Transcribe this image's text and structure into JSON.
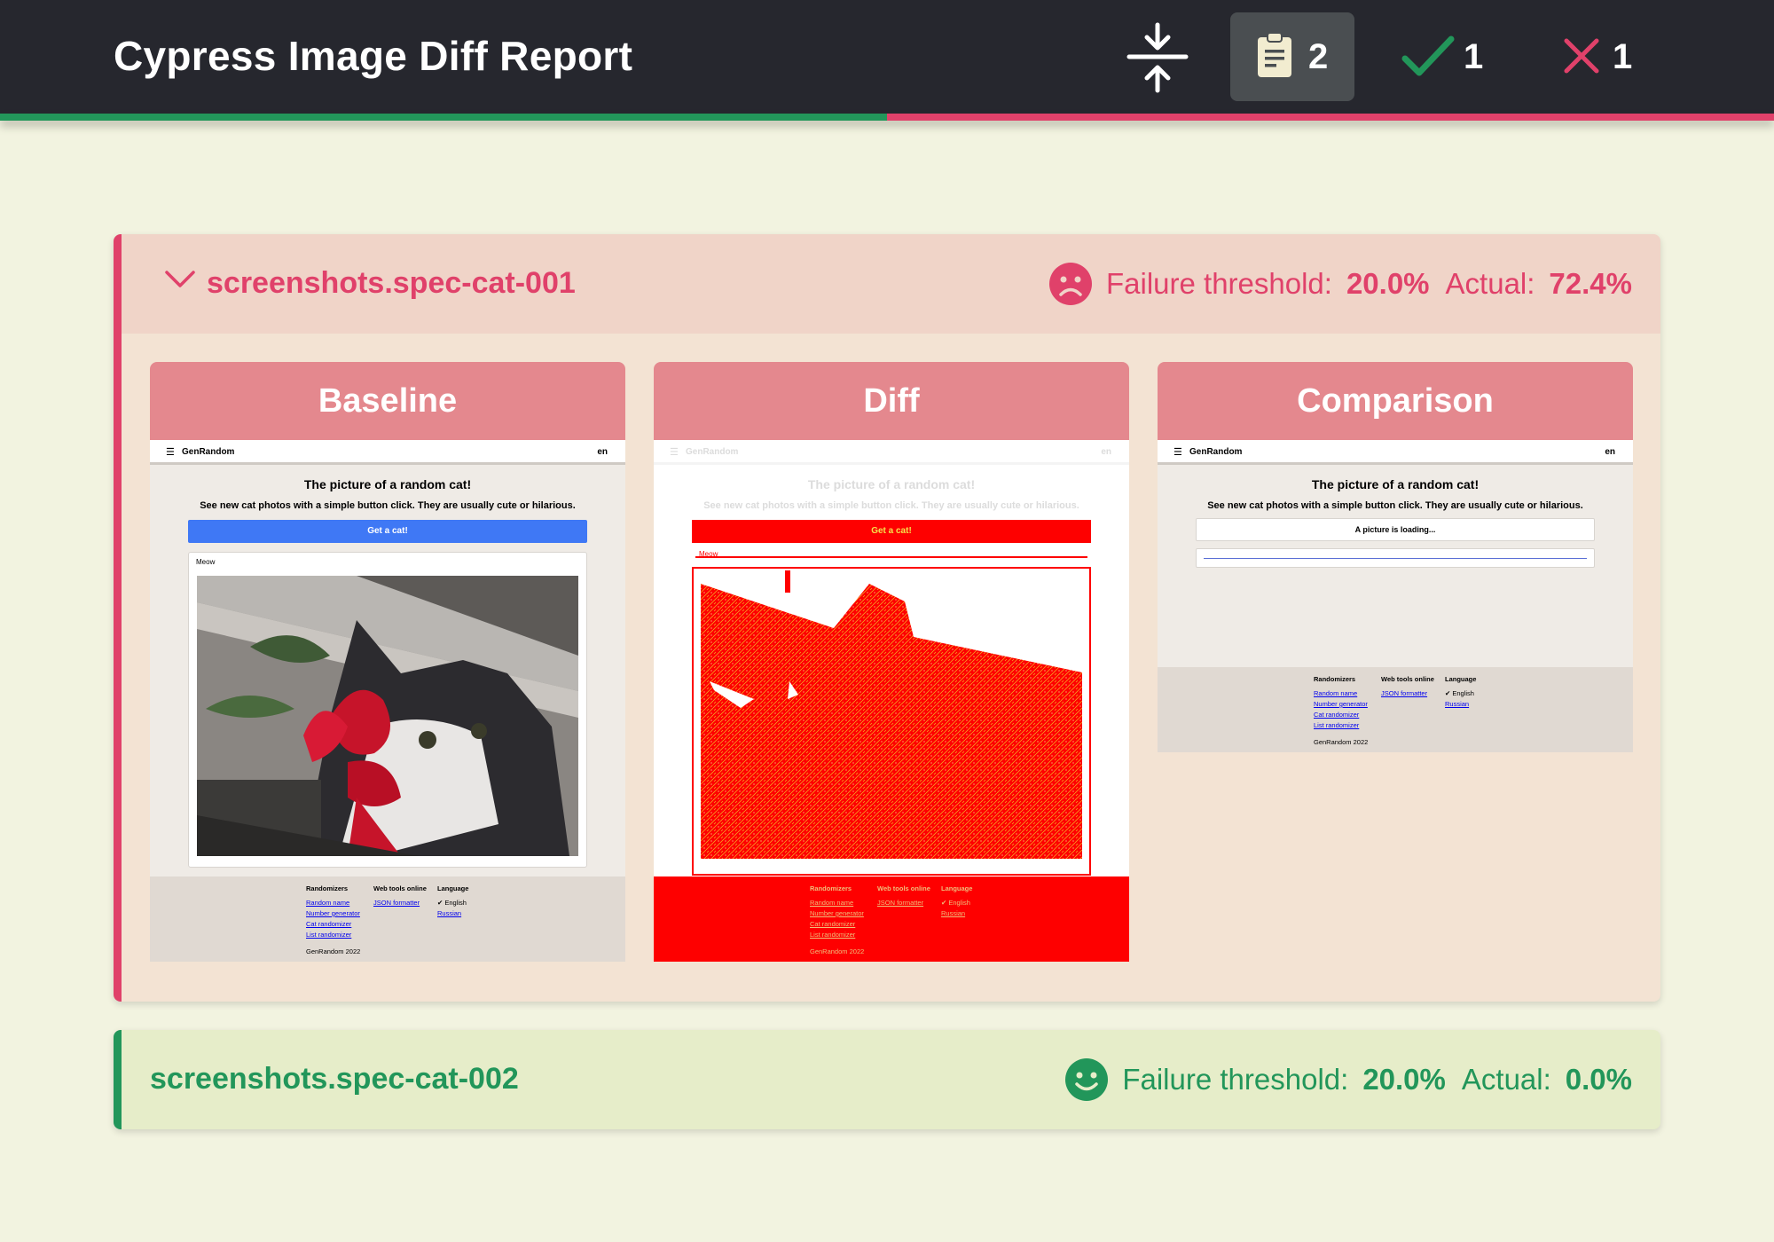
{
  "header": {
    "title": "Cypress Image Diff Report",
    "total_count": "2",
    "pass_count": "1",
    "fail_count": "1"
  },
  "colors": {
    "pass": "#22965a",
    "fail": "#e0416a",
    "header_bg": "#26272e",
    "panel_head": "#e4888e",
    "diff_red": "#fe0000"
  },
  "tests": [
    {
      "name": "screenshots.spec-cat-001",
      "status": "failed",
      "threshold_label": "Failure threshold:",
      "threshold": "20.0%",
      "actual_label": "Actual:",
      "actual": "72.4%",
      "expanded": true,
      "panels": {
        "baseline": "Baseline",
        "diff": "Diff",
        "comparison": "Comparison"
      }
    },
    {
      "name": "screenshots.spec-cat-002",
      "status": "passed",
      "threshold_label": "Failure threshold:",
      "threshold": "20.0%",
      "actual_label": "Actual:",
      "actual": "0.0%",
      "expanded": false
    }
  ],
  "shot": {
    "brand": "GenRandom",
    "lang": "en",
    "heading": "The picture of a random cat!",
    "subtitle": "See new cat photos with a simple button click. They are usually cute or hilarious.",
    "button": "Get a cat!",
    "caption": "Meow",
    "loading": "A picture is loading...",
    "diff_button_text": "Get a cat!",
    "footer": {
      "col1_head": "Randomizers",
      "col1_links": [
        "Random name",
        "Number generator",
        "Cat randomizer",
        "List randomizer"
      ],
      "col2_head": "Web tools online",
      "col2_links": [
        "JSON formatter"
      ],
      "col3_head": "Language",
      "col3_current": "✔ English",
      "col3_links": [
        "Russian"
      ],
      "copyright": "GenRandom 2022"
    }
  }
}
